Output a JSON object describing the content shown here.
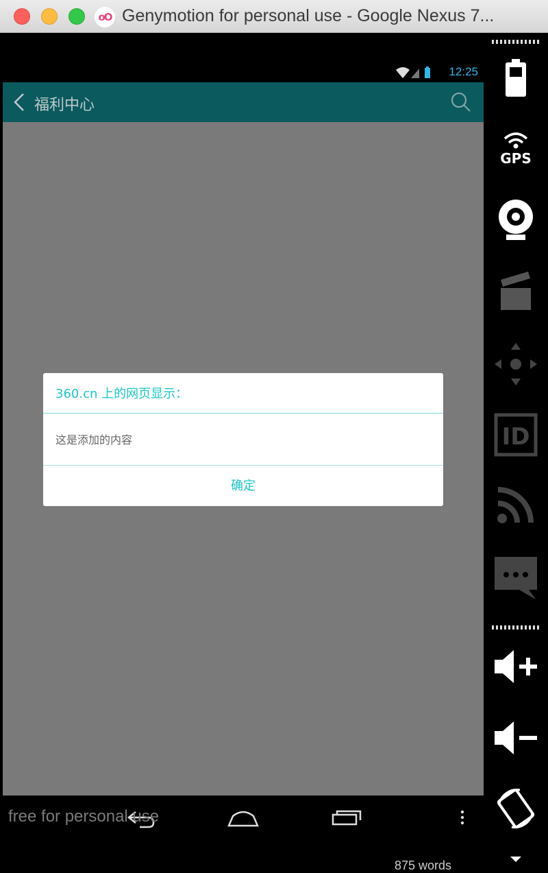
{
  "window": {
    "title": "Genymotion for personal use - Google Nexus 7...",
    "logo_text": "oO"
  },
  "statusbar": {
    "time": "12:25"
  },
  "actionbar": {
    "title": "福利中心"
  },
  "dialog": {
    "title": "360.cn 上的网页显示：",
    "message": "这是添加的内容",
    "ok_label": "确定"
  },
  "navbar": {
    "watermark": "free for personal use"
  },
  "sidebar": {
    "gps_label": "GPS",
    "id_label": "ID",
    "tools": [
      "battery-icon",
      "gps-icon",
      "webcam-icon",
      "video-capture-icon",
      "remote-control-icon",
      "identifiers-icon",
      "network-icon",
      "sms-icon",
      "volume-up-icon",
      "volume-down-icon",
      "rotate-icon"
    ]
  },
  "peek_text": "875 words",
  "colors": {
    "accent": "#1bc6c4",
    "actionbar": "#0a5a5e",
    "status_time": "#33b5e5"
  }
}
